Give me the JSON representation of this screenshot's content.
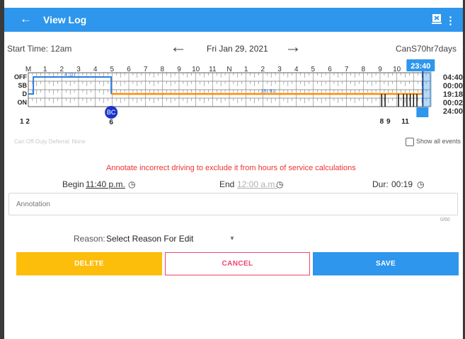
{
  "header": {
    "title": "View Log",
    "back_icon": "arrow-left-icon",
    "tracker_icon": "device-icon",
    "menu_icon": "more-vert-icon"
  },
  "log": {
    "start_time": "Start Time: 12am",
    "date": "Fri Jan 29, 2021",
    "ruleset": "CanS70hr7days"
  },
  "graph": {
    "hour_labels": [
      "M",
      "1",
      "2",
      "3",
      "4",
      "5",
      "6",
      "7",
      "8",
      "9",
      "10",
      "11",
      "N",
      "1",
      "2",
      "3",
      "4",
      "5",
      "6",
      "7",
      "8",
      "9",
      "10",
      "11",
      "M"
    ],
    "rows": [
      "OFF",
      "SB",
      "D",
      "ON"
    ],
    "totals": [
      "04:40",
      "00:00",
      "19:18",
      "00:02",
      "24:00"
    ],
    "bubble_time": "23:40",
    "segment_labels": [
      "4:37",
      "18:01"
    ],
    "event_marker": "BC",
    "bottom_labels": {
      "left": "1 2",
      "middle": "6",
      "right_a": "8",
      "right_b": "9",
      "right_c": "11"
    },
    "colors": {
      "off": "#2b7de1",
      "driving": "#ff8c00",
      "marker": "#1a35c9"
    }
  },
  "deferral": "Can Off-Duty Deferral: None",
  "show_all_events": "Show all events",
  "notice": "Annotate incorrect driving to exclude it from hours of service calculations",
  "edit": {
    "begin_label": "Begin",
    "begin_value": "11:40 p.m.",
    "end_label": "End",
    "end_value": "12:00 a.m.",
    "dur_label": "Dur:",
    "dur_value": "00:19"
  },
  "annotation": {
    "placeholder": "Annotation",
    "counter": "0/60"
  },
  "reason": {
    "label": "Reason:",
    "value": "Select Reason For Edit"
  },
  "buttons": {
    "delete": "DELETE",
    "cancel": "CANCEL",
    "save": "SAVE"
  }
}
